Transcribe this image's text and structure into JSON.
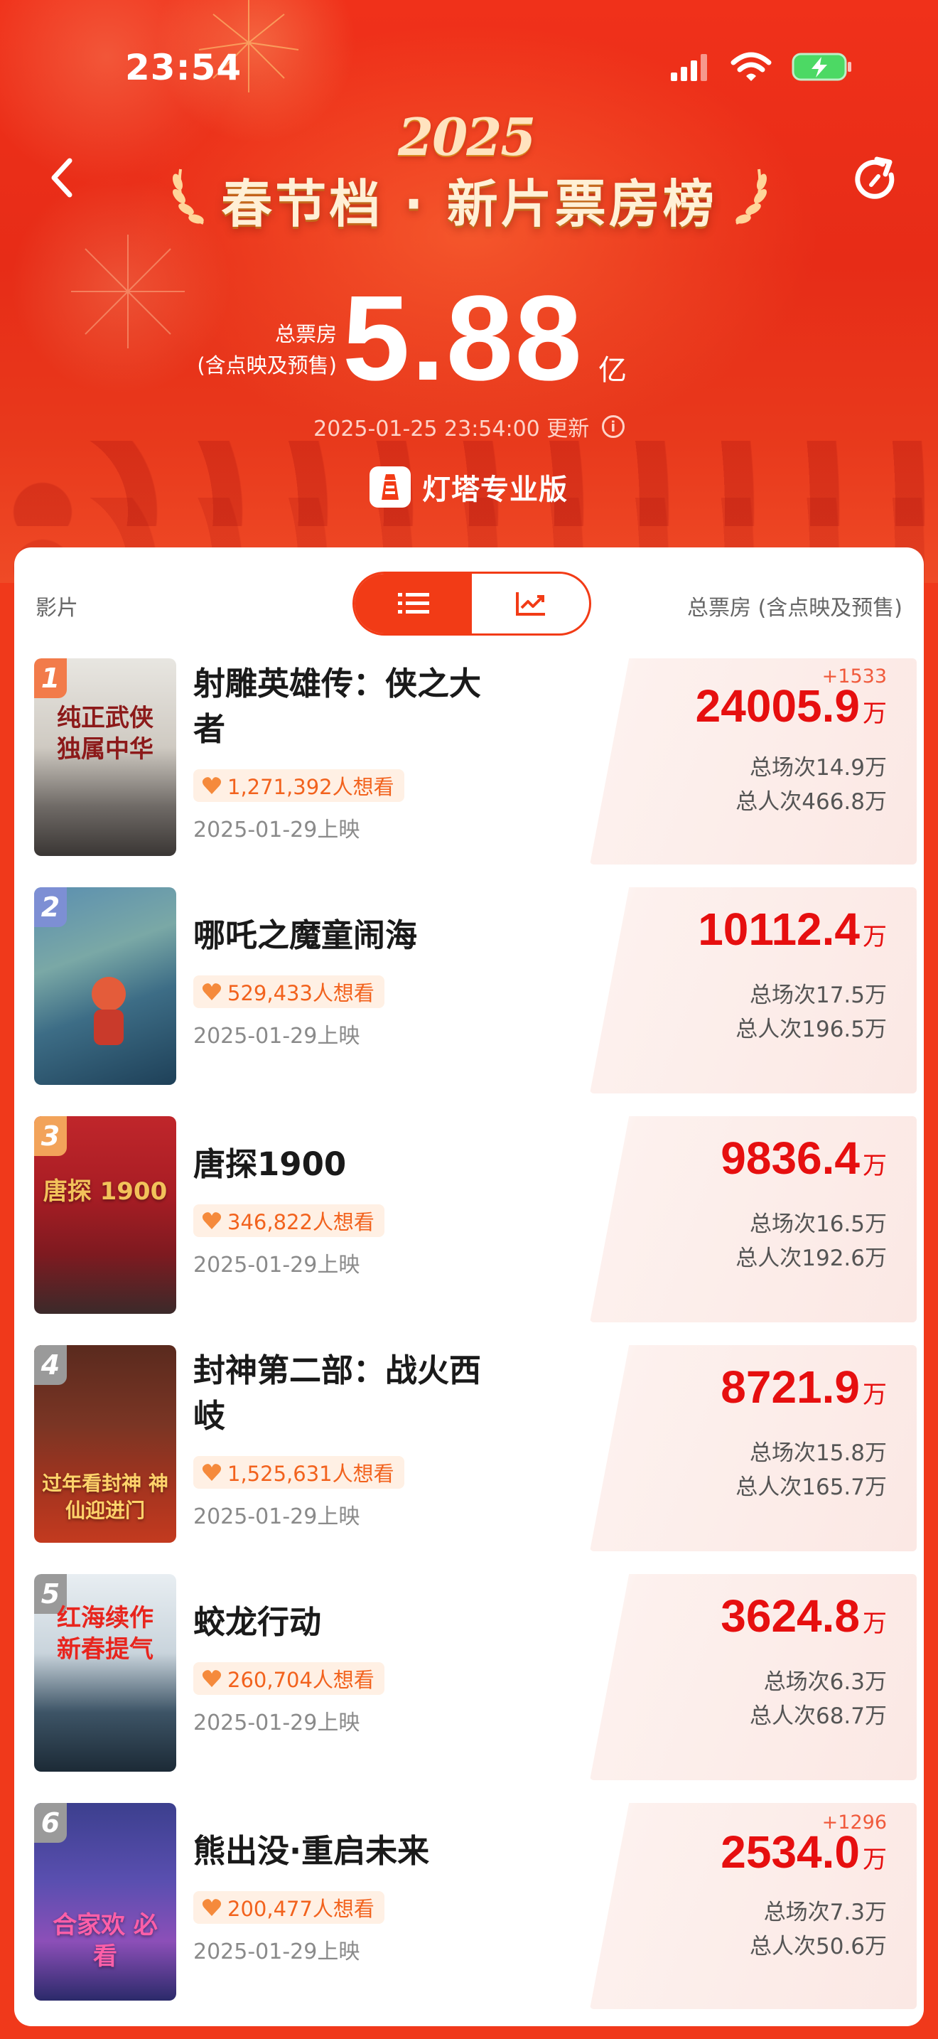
{
  "status_bar": {
    "time": "23:54"
  },
  "header": {
    "year_deco": "2025",
    "title": "春节档 · 新片票房榜",
    "total_label_line1": "总票房",
    "total_label_line2": "(含点映及预售)",
    "total_value": "5.88",
    "total_unit": "亿",
    "update_time": "2025-01-25 23:54:00 更新",
    "brand_name": "灯塔专业版"
  },
  "list_header": {
    "film_label": "影片",
    "total_label": "总票房 (含点映及预售)"
  },
  "films": [
    {
      "rank": "1",
      "name_line1": "射雕英雄传：侠之大",
      "name_line2": "者",
      "want": "1,271,392人想看",
      "release": "2025-01-29上映",
      "gross": "24005.9",
      "gross_unit": "万",
      "delta": "+1533",
      "sessions": "总场次14.9万",
      "attendance": "总人次466.8万",
      "poster_text": "纯正武侠 独属中华"
    },
    {
      "rank": "2",
      "name_line1": "哪吒之魔童闹海",
      "name_line2": "",
      "want": "529,433人想看",
      "release": "2025-01-29上映",
      "gross": "10112.4",
      "gross_unit": "万",
      "delta": "",
      "sessions": "总场次17.5万",
      "attendance": "总人次196.5万",
      "poster_text": ""
    },
    {
      "rank": "3",
      "name_line1": "唐探1900",
      "name_line2": "",
      "want": "346,822人想看",
      "release": "2025-01-29上映",
      "gross": "9836.4",
      "gross_unit": "万",
      "delta": "",
      "sessions": "总场次16.5万",
      "attendance": "总人次192.6万",
      "poster_text": "唐探 1900"
    },
    {
      "rank": "4",
      "name_line1": "封神第二部：战火西",
      "name_line2": "岐",
      "want": "1,525,631人想看",
      "release": "2025-01-29上映",
      "gross": "8721.9",
      "gross_unit": "万",
      "delta": "",
      "sessions": "总场次15.8万",
      "attendance": "总人次165.7万",
      "poster_text": "过年看封神 神仙迎进门"
    },
    {
      "rank": "5",
      "name_line1": "蛟龙行动",
      "name_line2": "",
      "want": "260,704人想看",
      "release": "2025-01-29上映",
      "gross": "3624.8",
      "gross_unit": "万",
      "delta": "",
      "sessions": "总场次6.3万",
      "attendance": "总人次68.7万",
      "poster_text": "红海续作 新春提气"
    },
    {
      "rank": "6",
      "name_line1": "熊出没·重启未来",
      "name_line2": "",
      "want": "200,477人想看",
      "release": "2025-01-29上映",
      "gross": "2534.0",
      "gross_unit": "万",
      "delta": "+1296",
      "sessions": "总场次7.3万",
      "attendance": "总人次50.6万",
      "poster_text": "合家欢 必看"
    }
  ],
  "colors": {
    "header_red": "#f0311a",
    "accent": "#f23b16",
    "gross_red": "#e60f0f",
    "want_orange": "#f2621d"
  }
}
